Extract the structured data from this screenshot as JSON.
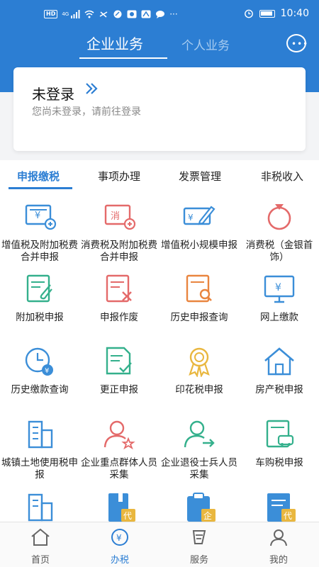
{
  "status_bar": {
    "time": "10:40",
    "network_badge": "HD",
    "signal_type": "4G"
  },
  "header": {
    "tabs": [
      {
        "label": "企业业务",
        "active": true
      },
      {
        "label": "个人业务",
        "active": false
      }
    ],
    "message_icon": "chat-dots-icon"
  },
  "login": {
    "title": "未登录",
    "subtitle": "您尚未登录，请前往登录"
  },
  "sub_tabs": [
    {
      "label": "申报缴税",
      "active": true
    },
    {
      "label": "事项办理",
      "active": false
    },
    {
      "label": "发票管理",
      "active": false
    },
    {
      "label": "非税收入",
      "active": false
    }
  ],
  "services": [
    {
      "label": "增值税及附加税费合并申报",
      "icon": "vat-invoice-icon"
    },
    {
      "label": "消费税及附加税费合并申报",
      "icon": "consumption-tax-icon"
    },
    {
      "label": "增值税小规模申报",
      "icon": "card-edit-icon"
    },
    {
      "label": "消费税（金银首饰）",
      "icon": "ring-icon"
    },
    {
      "label": "附加税申报",
      "icon": "document-attach-icon"
    },
    {
      "label": "申报作废",
      "icon": "document-cancel-icon"
    },
    {
      "label": "历史申报查询",
      "icon": "document-search-icon"
    },
    {
      "label": "网上缴款",
      "icon": "monitor-yen-icon"
    },
    {
      "label": "历史缴款查询",
      "icon": "clock-yen-icon"
    },
    {
      "label": "更正申报",
      "icon": "document-check-icon"
    },
    {
      "label": "印花税申报",
      "icon": "award-badge-icon"
    },
    {
      "label": "房产税申报",
      "icon": "house-icon"
    },
    {
      "label": "城镇土地使用税申报",
      "icon": "buildings-icon"
    },
    {
      "label": "企业重点群体人员采集",
      "icon": "person-star-icon"
    },
    {
      "label": "企业退役士兵人员采集",
      "icon": "person-arrow-icon"
    },
    {
      "label": "车购税申报",
      "icon": "document-car-icon"
    },
    {
      "label": "",
      "icon": "buildings-icon"
    },
    {
      "label": "",
      "icon": "book-proxy-icon"
    },
    {
      "label": "",
      "icon": "clipboard-enterprise-icon"
    },
    {
      "label": "",
      "icon": "document-proxy-icon"
    }
  ],
  "proxy_badge": "代",
  "enterprise_badge": "企",
  "consumption_badge": "消",
  "bottom_nav": [
    {
      "label": "首页",
      "icon": "home-icon",
      "active": false
    },
    {
      "label": "办税",
      "icon": "yen-circle-icon",
      "active": true
    },
    {
      "label": "服务",
      "icon": "service-icon",
      "active": false
    },
    {
      "label": "我的",
      "icon": "user-icon",
      "active": false
    }
  ],
  "colors": {
    "primary": "#2c7ed3",
    "icon_blue": "#3b8ed8",
    "icon_green": "#34b08c",
    "icon_red": "#e46a6a",
    "icon_gold": "#e9b73f"
  }
}
